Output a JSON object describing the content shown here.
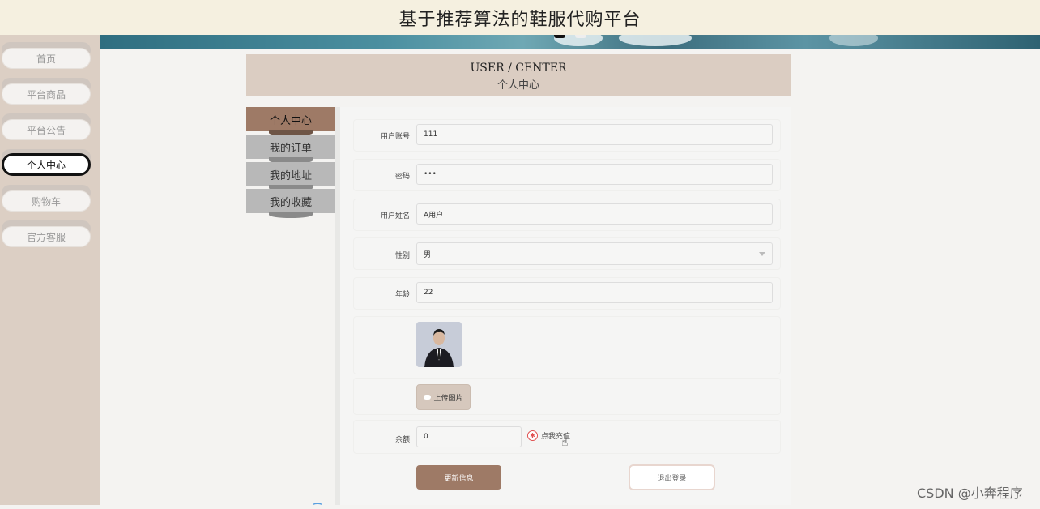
{
  "app": {
    "title": "基于推荐算法的鞋服代购平台"
  },
  "sidebar": {
    "items": [
      {
        "label": "首页",
        "active": false
      },
      {
        "label": "平台商品",
        "active": false
      },
      {
        "label": "平台公告",
        "active": false
      },
      {
        "label": "个人中心",
        "active": true
      },
      {
        "label": "购物车",
        "active": false
      },
      {
        "label": "官方客服",
        "active": false
      }
    ]
  },
  "page_header": {
    "en": "USER / CENTER",
    "cn": "个人中心"
  },
  "tabs": [
    {
      "label": "个人中心",
      "active": true
    },
    {
      "label": "我的订单",
      "active": false
    },
    {
      "label": "我的地址",
      "active": false
    },
    {
      "label": "我的收藏",
      "active": false
    }
  ],
  "form": {
    "account": {
      "label": "用户账号",
      "value": "111"
    },
    "password": {
      "label": "密码",
      "value": "•••"
    },
    "name": {
      "label": "用户姓名",
      "value": "A用户"
    },
    "gender": {
      "label": "性别",
      "value": "男"
    },
    "age": {
      "label": "年龄",
      "value": "22"
    },
    "upload_label": "上传图片",
    "balance": {
      "label": "余额",
      "value": "0"
    },
    "recharge_label": "点我充值",
    "update_label": "更新信息",
    "logout_label": "退出登录"
  },
  "watermark": "CSDN @小奔程序",
  "colors": {
    "accent": "#9e7a66",
    "sidebar_bg": "#dccfc4",
    "header_bg": "#dbcdc2"
  }
}
